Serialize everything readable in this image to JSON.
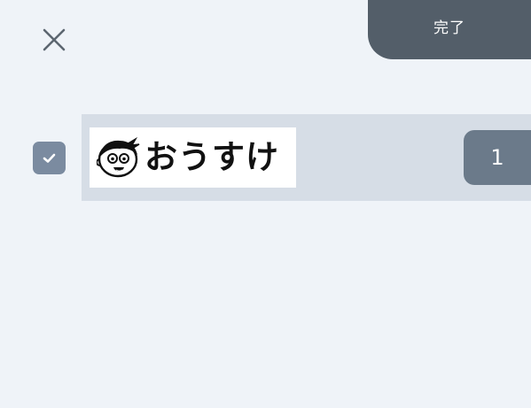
{
  "header": {
    "close_icon": "close-icon",
    "done_label": "完了"
  },
  "colors": {
    "background": "#eff3f8",
    "done_button": "#535e69",
    "row_background": "#d6dde6",
    "checkbox": "#7b8ba0",
    "quantity_badge": "#6b7a8a"
  },
  "items": [
    {
      "checked": true,
      "check_icon": "checkmark-icon",
      "avatar_icon": "cartoon-boy-face-icon",
      "name": "おうすけ",
      "quantity": "1"
    }
  ]
}
